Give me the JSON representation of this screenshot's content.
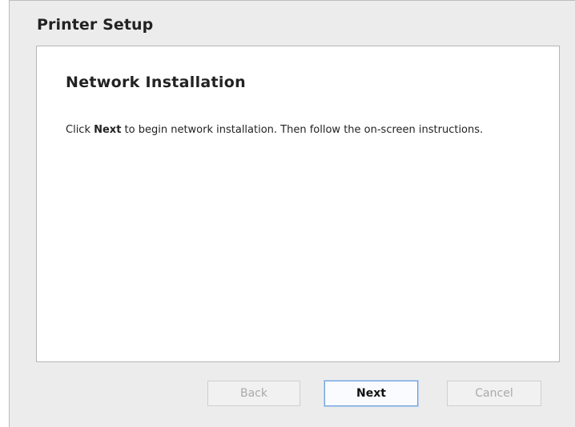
{
  "window": {
    "title": "Printer Setup"
  },
  "panel": {
    "heading": "Network Installation",
    "body_prefix": "Click ",
    "body_bold": "Next",
    "body_suffix": " to begin network installation. Then follow the on-screen instructions."
  },
  "buttons": {
    "back_label": "Back",
    "next_label": "Next",
    "cancel_label": "Cancel",
    "back_enabled": false,
    "next_enabled": true,
    "cancel_enabled": false
  }
}
